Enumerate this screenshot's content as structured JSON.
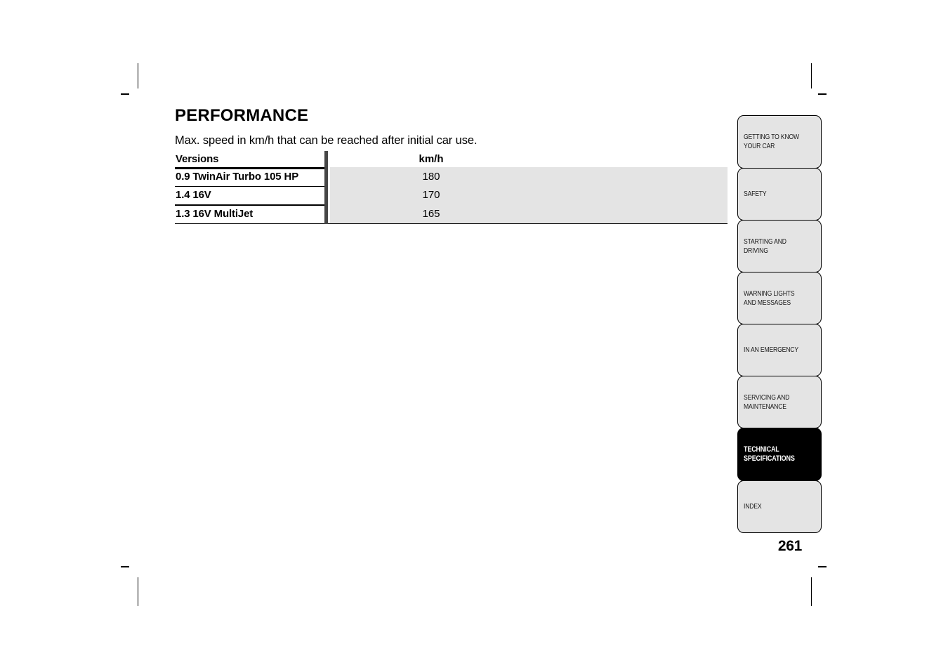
{
  "document": {
    "page_number": "261"
  },
  "main": {
    "title": "PERFORMANCE",
    "intro": "Max. speed in km/h that can be reached after initial car use.",
    "table": {
      "headers": [
        "Versions",
        "km/h"
      ],
      "rows": [
        {
          "version": "0.9 TwinAir Turbo 105 HP",
          "kmh": "180"
        },
        {
          "version": "1.4 16V",
          "kmh": "170"
        },
        {
          "version": "1.3 16V MultiJet",
          "kmh": "165"
        }
      ]
    }
  },
  "sidebar": {
    "tabs": [
      {
        "label": "GETTING TO KNOW YOUR CAR",
        "active": false
      },
      {
        "label": "SAFETY",
        "active": false
      },
      {
        "label": "STARTING AND DRIVING",
        "active": false
      },
      {
        "label": "WARNING LIGHTS AND MESSAGES",
        "active": false
      },
      {
        "label": "IN AN EMERGENCY",
        "active": false
      },
      {
        "label": "SERVICING AND MAINTENANCE",
        "active": false
      },
      {
        "label": "TECHNICAL SPECIFICATIONS",
        "active": true
      },
      {
        "label": "INDEX",
        "active": false
      }
    ]
  },
  "colors": {
    "table_shade": "#e4e4e4",
    "divider": "#464646",
    "active_tab_bg": "#000000",
    "tab_bg": "#e4e4e4"
  }
}
